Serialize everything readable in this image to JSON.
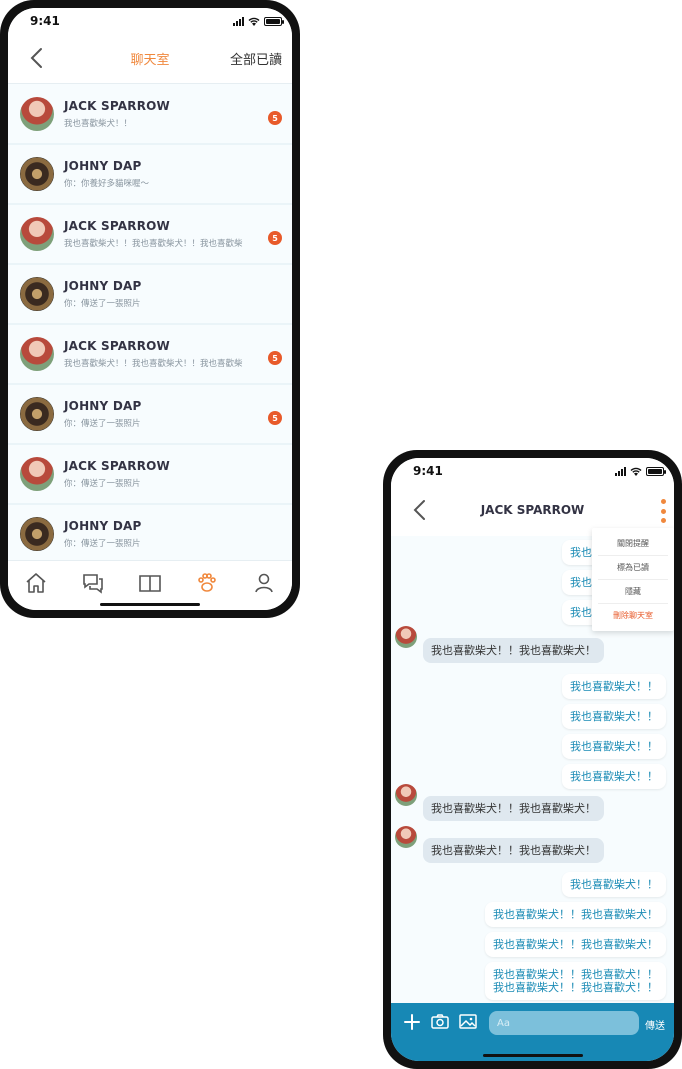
{
  "status": {
    "time": "9:41"
  },
  "chat_list": {
    "title": "聊天室",
    "read_all": "全部已讀",
    "items": [
      {
        "name": "JACK SPARROW",
        "preview": "我也喜歡柴犬！！",
        "badge": "5",
        "avatar": "jack"
      },
      {
        "name": "JOHNY DAP",
        "preview": "你：你養好多貓咪喔～",
        "badge": "",
        "avatar": "johny"
      },
      {
        "name": "JACK SPARROW",
        "preview": "我也喜歡柴犬！！我也喜歡柴犬！！我也喜歡柴",
        "badge": "5",
        "avatar": "jack"
      },
      {
        "name": "JOHNY DAP",
        "preview": "你：傳送了一張照片",
        "badge": "",
        "avatar": "johny"
      },
      {
        "name": "JACK SPARROW",
        "preview": "我也喜歡柴犬！！我也喜歡柴犬！！我也喜歡柴",
        "badge": "5",
        "avatar": "jack"
      },
      {
        "name": "JOHNY DAP",
        "preview": "你：傳送了一張照片",
        "badge": "5",
        "avatar": "johny"
      },
      {
        "name": "JACK SPARROW",
        "preview": "你：傳送了一張照片",
        "badge": "",
        "avatar": "jack"
      },
      {
        "name": "JOHNY DAP",
        "preview": "你：傳送了一張照片",
        "badge": "",
        "avatar": "johny"
      }
    ],
    "tabs": [
      "home-icon",
      "chat-icon",
      "book-icon",
      "paw-icon",
      "user-icon"
    ]
  },
  "conversation": {
    "title": "JACK SPARROW",
    "menu": [
      "關閉提醒",
      "標為已讀",
      "隱藏",
      "刪除聊天室"
    ],
    "messages": [
      {
        "dir": "out",
        "text": "我也喜歡柴犬！！"
      },
      {
        "dir": "out",
        "text": "我也喜歡柴犬！！"
      },
      {
        "dir": "out",
        "text": "我也喜歡柴犬！！"
      },
      {
        "dir": "in",
        "text": "我也喜歡柴犬！！我也喜歡柴犬！"
      },
      {
        "dir": "out",
        "text": "我也喜歡柴犬！！"
      },
      {
        "dir": "out",
        "text": "我也喜歡柴犬！！"
      },
      {
        "dir": "out",
        "text": "我也喜歡柴犬！！"
      },
      {
        "dir": "out",
        "text": "我也喜歡柴犬！！"
      },
      {
        "dir": "in",
        "text": "我也喜歡柴犬！！我也喜歡柴犬！"
      },
      {
        "dir": "in",
        "text": "我也喜歡柴犬！！我也喜歡柴犬！"
      },
      {
        "dir": "out",
        "text": "我也喜歡柴犬！！"
      },
      {
        "dir": "out",
        "text": "我也喜歡柴犬！！我也喜歡柴犬！"
      },
      {
        "dir": "out",
        "text": "我也喜歡柴犬！！我也喜歡柴犬！"
      },
      {
        "dir": "out",
        "text": "我也喜歡柴犬！！我也喜歡犬！！\n我也喜歡柴犬！！我也喜歡犬！！"
      }
    ],
    "input_placeholder": "Aa",
    "send_label": "傳送"
  },
  "colors": {
    "accent": "#f0883d",
    "primary": "#1788b5",
    "badge": "#e85a2a"
  }
}
